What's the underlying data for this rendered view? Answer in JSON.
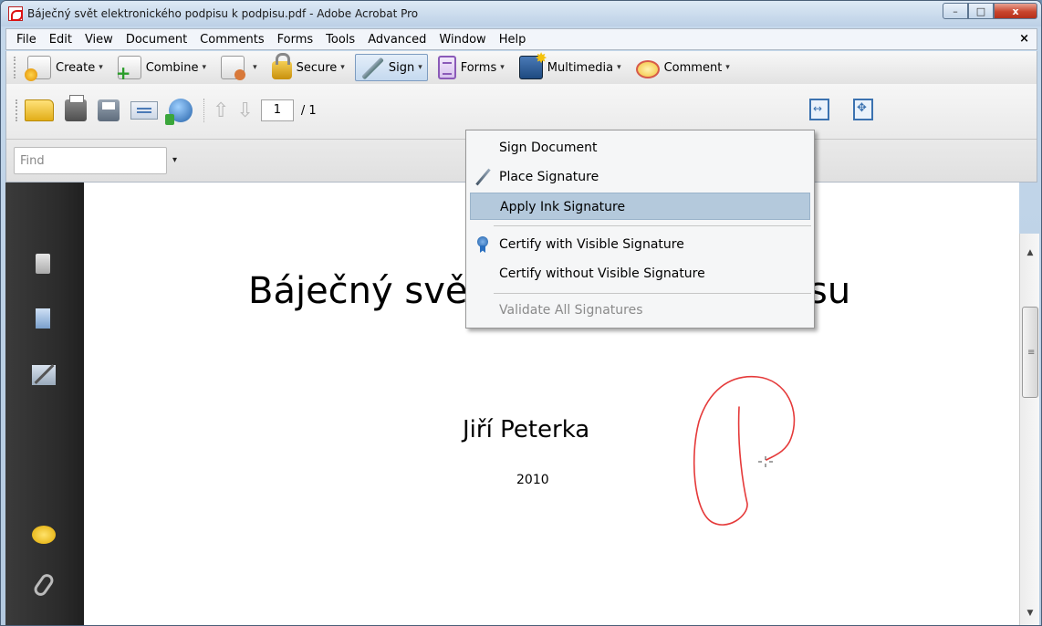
{
  "window": {
    "title": "Báječný svět elektronického podpisu k podpisu.pdf - Adobe Acrobat Pro",
    "controls": {
      "minimize": "–",
      "maximize": "□",
      "close": "x"
    }
  },
  "menubar": {
    "items": [
      "File",
      "Edit",
      "View",
      "Document",
      "Comments",
      "Forms",
      "Tools",
      "Advanced",
      "Window",
      "Help"
    ],
    "close": "×"
  },
  "tasks": {
    "create": "Create",
    "combine": "Combine",
    "secure": "Secure",
    "sign": "Sign",
    "forms": "Forms",
    "multimedia": "Multimedia",
    "comment": "Comment",
    "caret": "▾"
  },
  "toolbar": {
    "page_current": "1",
    "page_total": "/ 1",
    "arrow_up": "⇧",
    "arrow_down": "⇩"
  },
  "find": {
    "placeholder": "Find",
    "caret": "▾"
  },
  "sign_menu": {
    "items": [
      "Sign Document",
      "Place Signature",
      "Apply Ink Signature",
      "Certify with Visible Signature",
      "Certify without Visible Signature",
      "Validate All Signatures"
    ],
    "highlighted": "Apply Ink Signature",
    "disabled": "Validate All Signatures"
  },
  "document": {
    "title_visible_start": "Báječný svět",
    "title_visible_end": "su",
    "author": "Jiří Peterka",
    "year": "2010"
  },
  "scrollbar": {
    "up": "▲",
    "down": "▼",
    "grip": "≡"
  },
  "colors": {
    "highlight": "#b4c9dc",
    "ink": "#e53a3a",
    "nav_pane": "#2e2e2e"
  }
}
